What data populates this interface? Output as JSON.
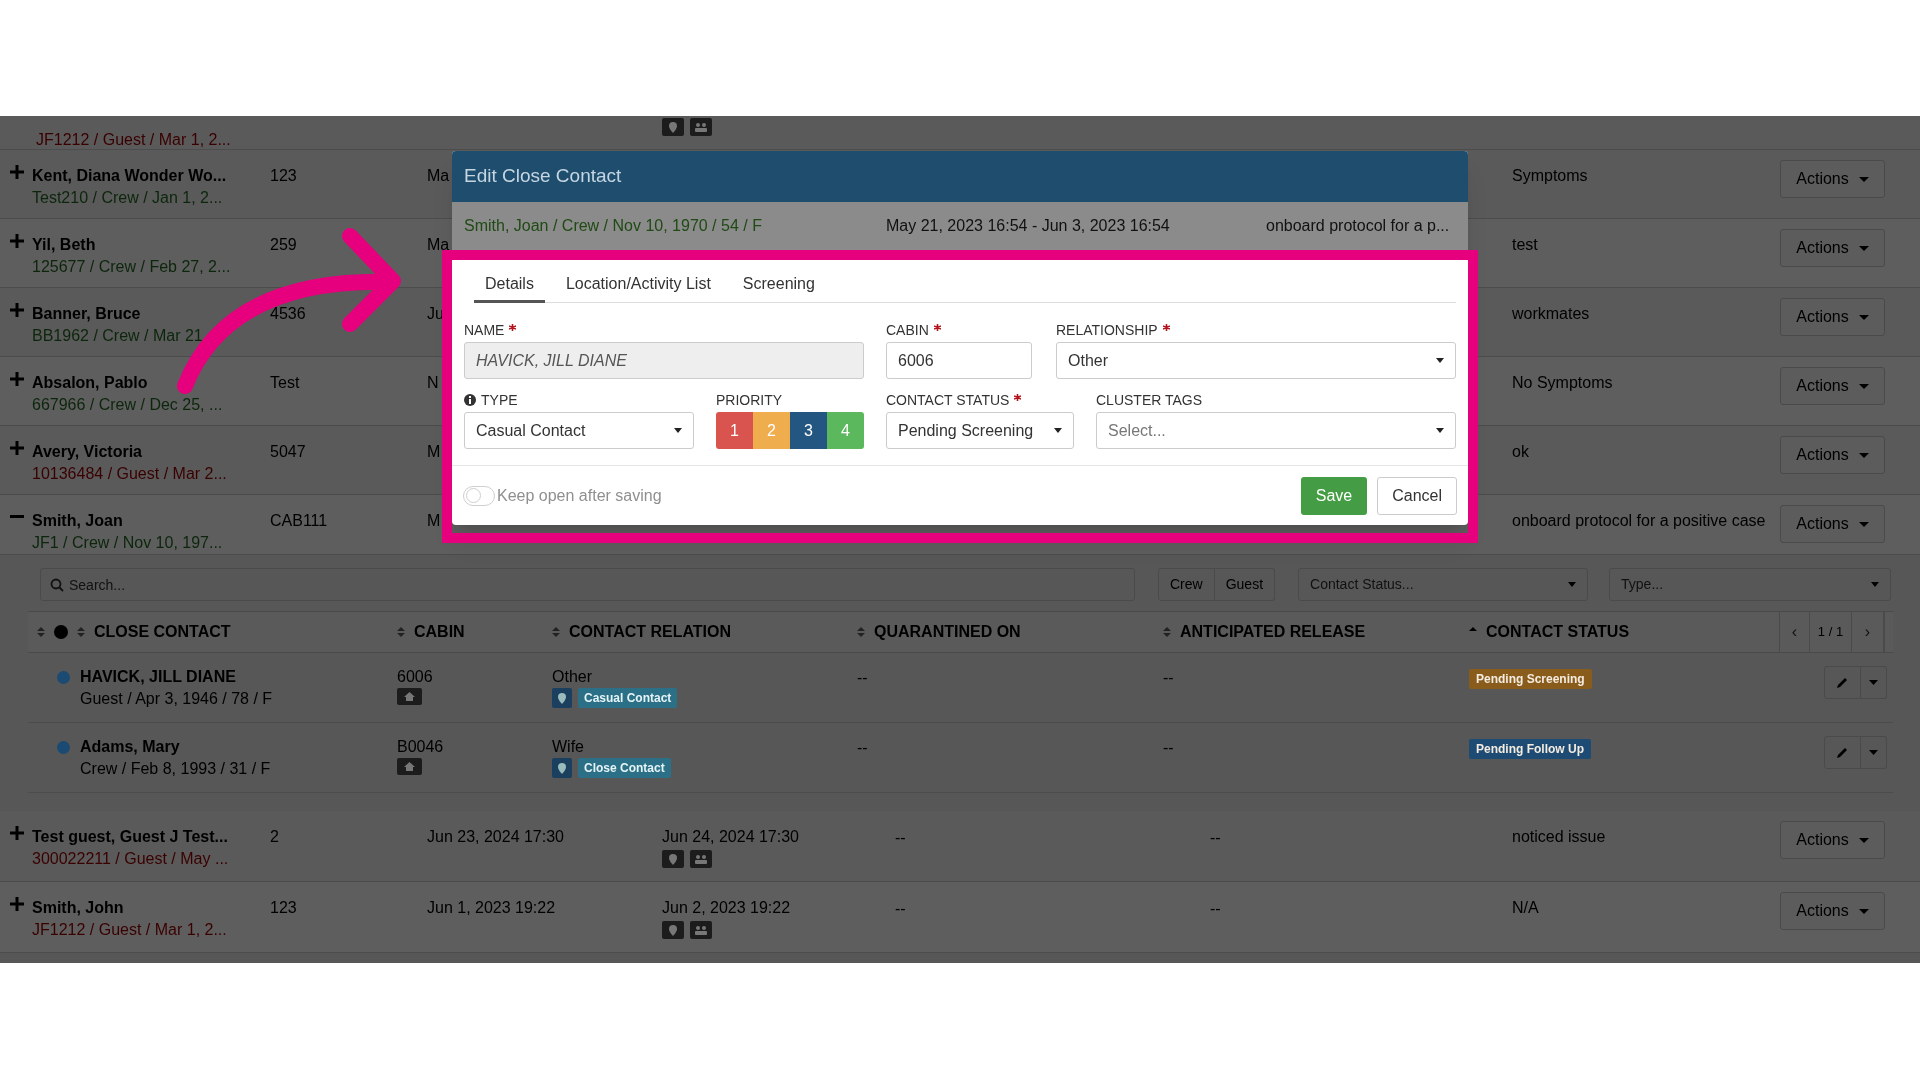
{
  "top_partial_row": {
    "sub": "JF1212 / Guest / Mar 1, 2...",
    "kind": "guest",
    "icons": true
  },
  "rows": [
    {
      "name": "Kent, Diana Wonder Wo...",
      "sub": "Test210 / Crew / Jan 1, 2...",
      "kind": "crew",
      "expanded": false,
      "cabin": "123",
      "start": "Ma",
      "notes": "Symptoms",
      "action": "Actions"
    },
    {
      "name": "Yil, Beth",
      "sub": "125677 / Crew / Feb 27, 2...",
      "kind": "crew",
      "expanded": false,
      "cabin": "259",
      "start": "Ma",
      "notes": "test",
      "action": "Actions"
    },
    {
      "name": "Banner, Bruce",
      "sub": "BB1962 / Crew / Mar 21",
      "kind": "crew",
      "expanded": false,
      "cabin": "4536",
      "start": "Ju",
      "notes": "workmates",
      "action": "Actions"
    },
    {
      "name": "Absalon, Pablo",
      "sub": "667966 / Crew / Dec 25, ...",
      "kind": "crew",
      "expanded": false,
      "cabin": "Test",
      "start": "N",
      "notes": "No Symptoms",
      "action": "Actions"
    },
    {
      "name": "Avery, Victoria",
      "sub": "10136484 / Guest / Mar 2...",
      "kind": "guest",
      "expanded": false,
      "cabin": "5047",
      "start": "M",
      "notes": "ok",
      "action": "Actions"
    },
    {
      "name": "Smith, Joan",
      "sub": "JF1 / Crew / Nov 10, 197...",
      "kind": "crew",
      "expanded": true,
      "cabin": "CAB111",
      "start": "M",
      "notes": "onboard protocol for a positive case",
      "action": "Actions"
    }
  ],
  "contacts_panel": {
    "search": {
      "placeholder": "Search..."
    },
    "filter_buttons": [
      {
        "label": "Crew"
      },
      {
        "label": "Guest"
      }
    ],
    "status_filter": {
      "placeholder": "Contact Status..."
    },
    "type_filter": {
      "placeholder": "Type..."
    },
    "columns": [
      {
        "label": "CLOSE CONTACT",
        "sorted": false
      },
      {
        "label": "CABIN",
        "sorted": false
      },
      {
        "label": "CONTACT RELATION",
        "sorted": false
      },
      {
        "label": "QUARANTINED ON",
        "sorted": false
      },
      {
        "label": "ANTICIPATED RELEASE",
        "sorted": false
      },
      {
        "label": "CONTACT STATUS",
        "sorted": true
      }
    ],
    "pager": {
      "prev": "‹",
      "page": "1 / 1",
      "next": "›"
    },
    "rows": [
      {
        "name": "HAVICK, JILL DIANE",
        "sub": "Guest / Apr 3, 1946 / 78 / F",
        "cabin": "6006",
        "relation": "Other",
        "tag": {
          "label": "Casual Contact",
          "color": "#2b7086"
        },
        "quarantined": "--",
        "release": "--",
        "status": {
          "label": "Pending Screening",
          "color": "#8a5c1c"
        }
      },
      {
        "name": "Adams, Mary",
        "sub": "Crew / Feb 8, 1993 / 31 / F",
        "cabin": "B0046",
        "relation": "Wife",
        "tag": {
          "label": "Close Contact",
          "color": "#2b7086"
        },
        "quarantined": "--",
        "release": "--",
        "status": {
          "label": "Pending Follow Up",
          "color": "#1d4b73"
        }
      }
    ]
  },
  "bottom_rows": [
    {
      "name": "Test guest, Guest J Test...",
      "sub": "300022211 / Guest / May ...",
      "kind": "guest",
      "expanded": false,
      "cabin": "2",
      "start": "Jun 23, 2024 17:30",
      "end": "Jun 24, 2024 17:30",
      "quarantined": "--",
      "release": "--",
      "notes": "noticed issue",
      "action": "Actions"
    },
    {
      "name": "Smith, John",
      "sub": "JF1212 / Guest / Mar 1, 2...",
      "kind": "guest",
      "expanded": false,
      "cabin": "123",
      "start": "Jun 1, 2023 19:22",
      "end": "Jun 2, 2023 19:22",
      "quarantined": "--",
      "release": "--",
      "notes": "N/A",
      "action": "Actions"
    }
  ],
  "modal": {
    "title": "Edit Close Contact",
    "info": [
      "Smith, Joan / Crew / Nov 10, 1970 / 54 / F",
      "May 21, 2023 16:54 - Jun 3, 2023 16:54",
      "onboard protocol for a p..."
    ],
    "tabs": [
      {
        "label": "Details",
        "selected": true
      },
      {
        "label": "Location/Activity List",
        "selected": false
      },
      {
        "label": "Screening",
        "selected": false
      }
    ],
    "name": {
      "label": "NAME",
      "required": true,
      "value": "HAVICK, JILL DIANE",
      "disabled": true
    },
    "cabin": {
      "label": "CABIN",
      "required": true,
      "value": "6006"
    },
    "relationship": {
      "label": "RELATIONSHIP",
      "required": true,
      "value": "Other"
    },
    "type": {
      "label": "TYPE",
      "value": "Casual Contact"
    },
    "priority": {
      "label": "PRIORITY",
      "options": [
        {
          "label": "1",
          "color": "#d9534f"
        },
        {
          "label": "2",
          "color": "#f0ad4e"
        },
        {
          "label": "3",
          "color": "#245682"
        },
        {
          "label": "4",
          "color": "#5cb85c"
        }
      ]
    },
    "contact_status": {
      "label": "CONTACT STATUS",
      "required": true,
      "value": "Pending Screening"
    },
    "cluster_tags": {
      "label": "CLUSTER TAGS",
      "placeholder": "Select..."
    },
    "keep_open": {
      "label": "Keep open after saving",
      "on": false
    },
    "save": "Save",
    "cancel": "Cancel"
  }
}
